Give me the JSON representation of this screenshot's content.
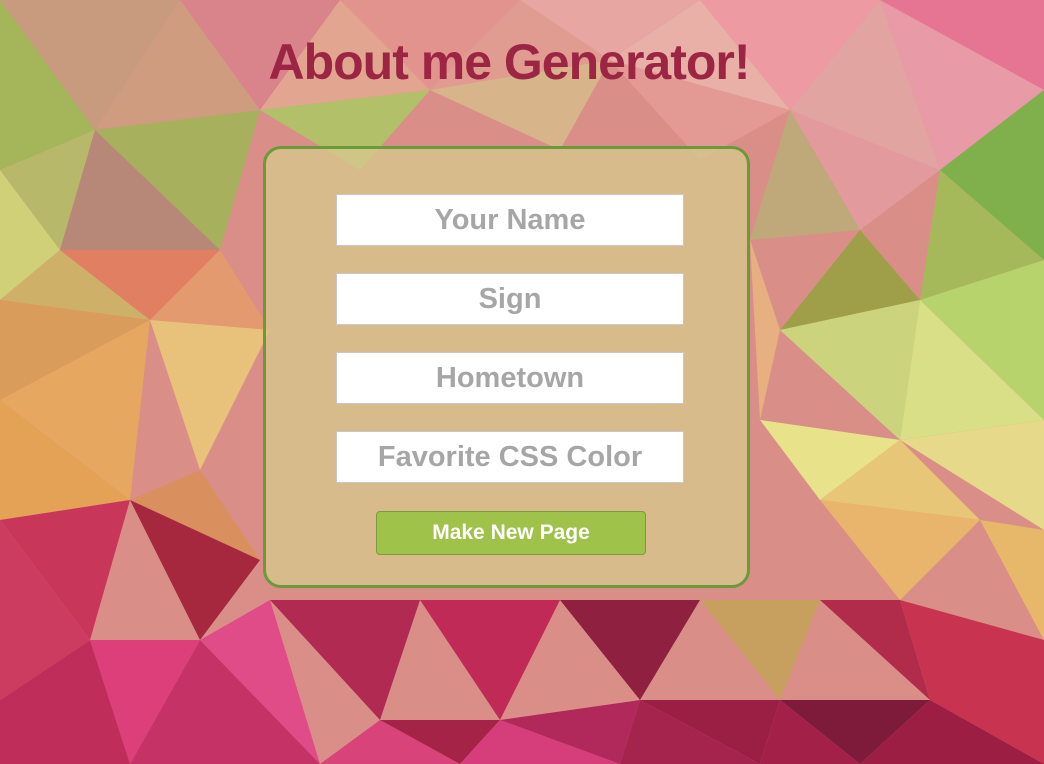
{
  "page": {
    "title": "About me Generator!"
  },
  "form": {
    "fields": [
      {
        "placeholder": "Your Name",
        "value": ""
      },
      {
        "placeholder": "Sign",
        "value": ""
      },
      {
        "placeholder": "Hometown",
        "value": ""
      },
      {
        "placeholder": "Favorite CSS Color",
        "value": ""
      }
    ],
    "submit_label": "Make New Page"
  },
  "colors": {
    "title": "#9b2543",
    "card_border": "#6a9a3a",
    "button": "#9fc24a"
  }
}
